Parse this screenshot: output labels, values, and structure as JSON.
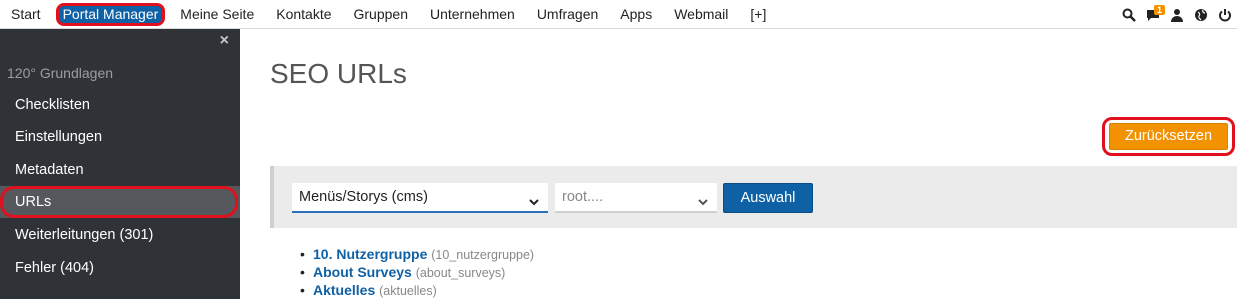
{
  "topnav": {
    "items": [
      {
        "label": "Start"
      },
      {
        "label": "Portal Manager",
        "active": true
      },
      {
        "label": "Meine Seite"
      },
      {
        "label": "Kontakte"
      },
      {
        "label": "Gruppen"
      },
      {
        "label": "Unternehmen"
      },
      {
        "label": "Umfragen"
      },
      {
        "label": "Apps"
      },
      {
        "label": "Webmail"
      },
      {
        "label": "[+]"
      }
    ],
    "icons": [
      "search-icon",
      "chat-icon",
      "user-icon",
      "globe-icon",
      "power-icon"
    ],
    "chat_badge": "1"
  },
  "sidebar": {
    "close": "×",
    "section": "120° Grundlagen",
    "items": [
      {
        "label": "Checklisten"
      },
      {
        "label": "Einstellungen"
      },
      {
        "label": "Metadaten"
      },
      {
        "label": "URLs",
        "active": true
      },
      {
        "label": "Weiterleitungen (301)"
      },
      {
        "label": "Fehler (404)"
      }
    ]
  },
  "main": {
    "title": "SEO URLs",
    "reset_label": "Zurücksetzen",
    "filter": {
      "type_select": "Menüs/Storys (cms)",
      "root_select": "root....",
      "submit_label": "Auswahl"
    },
    "urls": [
      {
        "title": "10. Nutzergruppe",
        "slug": "(10_nutzergruppe)"
      },
      {
        "title": "About Surveys",
        "slug": "(about_surveys)"
      },
      {
        "title": "Aktuelles",
        "slug": "(aktuelles)"
      }
    ]
  },
  "colors": {
    "accent_blue": "#0f61a5",
    "accent_orange": "#f39200",
    "highlight_red": "#e0101c",
    "sidebar_bg": "#2f3237"
  }
}
